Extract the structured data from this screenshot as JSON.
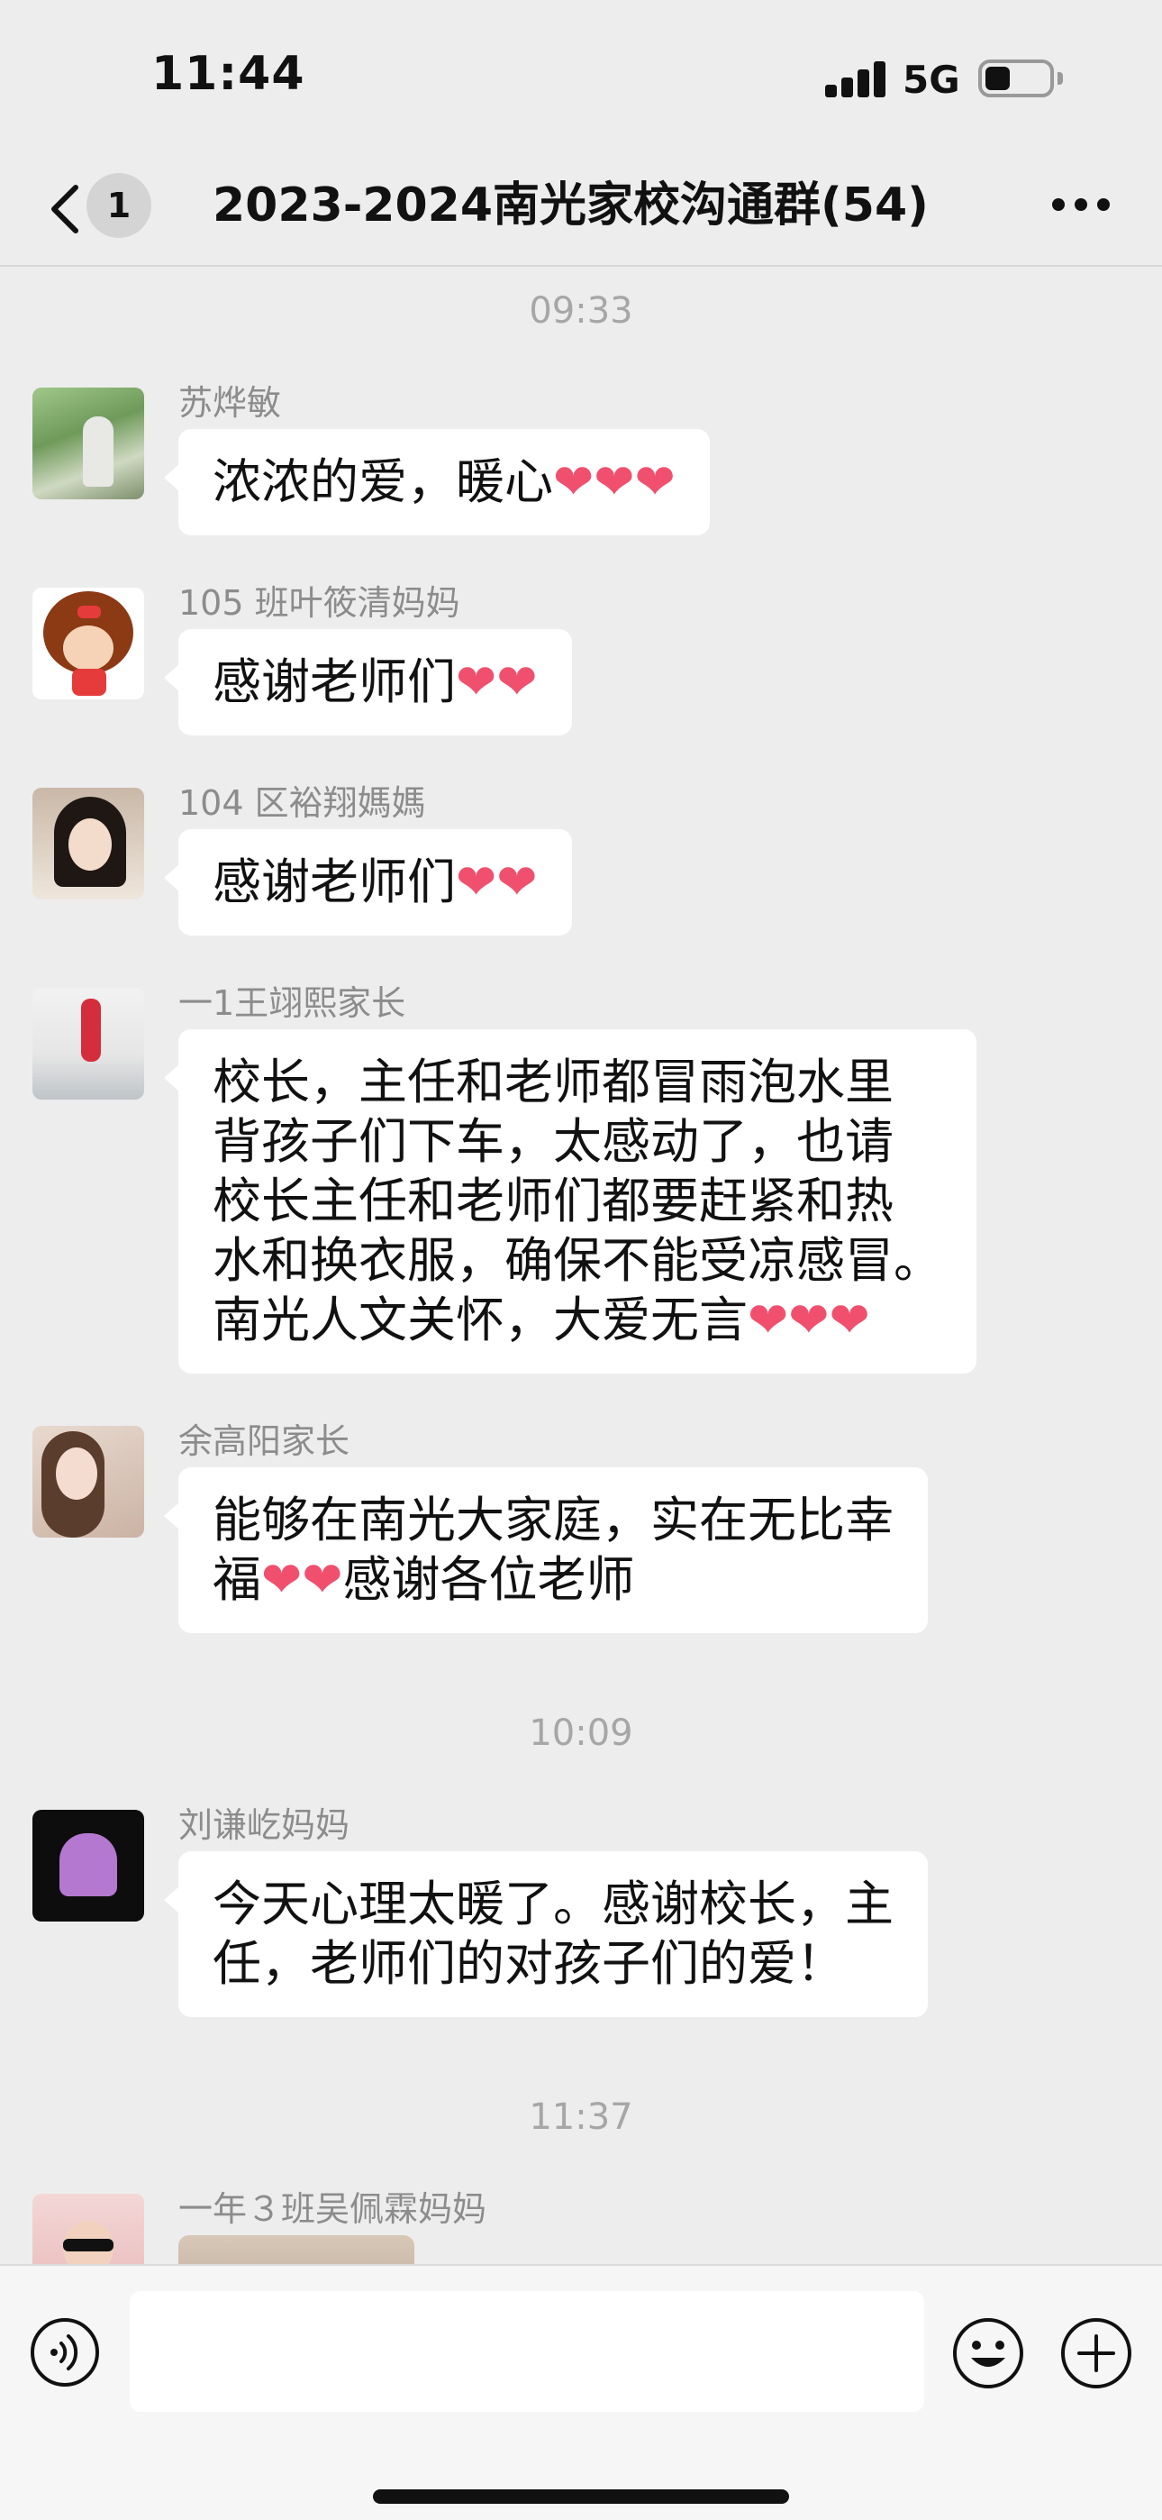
{
  "status_bar": {
    "time": "11:44",
    "network": "5G",
    "battery_level": 0.4
  },
  "nav": {
    "badge": "1",
    "title": "2023-2024南光家校沟通群(54)"
  },
  "timestamps": [
    "09:33",
    "10:09",
    "11:37"
  ],
  "messages": [
    {
      "sender": "苏烨敏",
      "lines": [
        "浓浓的爱，暖心"
      ],
      "hearts": "❤❤❤"
    },
    {
      "sender": "105 班叶筱清妈妈",
      "lines": [
        "感谢老师们"
      ],
      "hearts": "❤❤"
    },
    {
      "sender": "104 区裕翔媽媽",
      "lines": [
        "感谢老师们"
      ],
      "hearts": "❤❤"
    },
    {
      "sender": "一1王翊熙家长",
      "lines": [
        "校长，主任和老师都冒雨泡水里",
        "背孩子们下车，太感动了，也请",
        "校长主任和老师们都要赶紧和热",
        "水和换衣服，确保不能受凉感冒。",
        "南光人文关怀，大爱无言"
      ],
      "hearts": "❤❤❤"
    },
    {
      "sender": "余高阳家长",
      "lines": [
        "能够在南光大家庭，实在无比幸",
        "福",
        "感谢各位老师"
      ],
      "hearts": "❤❤"
    },
    {
      "sender": "刘谦屹妈妈",
      "lines": [
        "今天心理太暖了。感谢校长，主",
        "任，老师们的对孩子们的爱！"
      ]
    },
    {
      "sender": "一年３班吴佩霖妈妈"
    }
  ],
  "colors": {
    "background": "#ededed",
    "bubble": "#ffffff",
    "heart": "#f0506e",
    "timestamp": "#a6a6a6",
    "sender": "#8c8c8c"
  },
  "icons": [
    "back-chevron-icon",
    "more-dots-icon",
    "voice-icon",
    "emoji-icon",
    "plus-icon"
  ]
}
